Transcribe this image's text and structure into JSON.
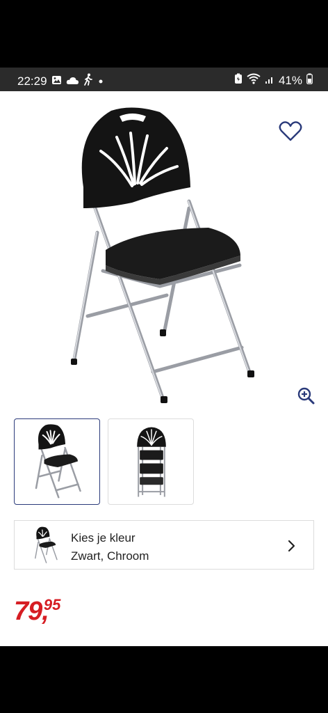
{
  "status_bar": {
    "time": "22:29",
    "battery": "41%",
    "left_icons": [
      "gallery-icon",
      "cloud-icon",
      "walking-icon",
      "dot-icon"
    ],
    "right_icons": [
      "battery-saver-icon",
      "wifi-icon",
      "signal-icon",
      "battery-icon"
    ]
  },
  "product": {
    "favorite_icon": "heart-outline-icon",
    "zoom_icon": "zoom-in-icon",
    "thumbnails": [
      "front-view",
      "folded-view"
    ],
    "selected_thumbnail": 0,
    "accent_color": "#2a3a7a"
  },
  "color_picker": {
    "title": "Kies je kleur",
    "value": "Zwart, Chroom",
    "chevron_icon": "chevron-right-icon"
  },
  "price": {
    "integer": "79",
    "separator": ",",
    "decimals": "95",
    "color": "#d61d23"
  }
}
